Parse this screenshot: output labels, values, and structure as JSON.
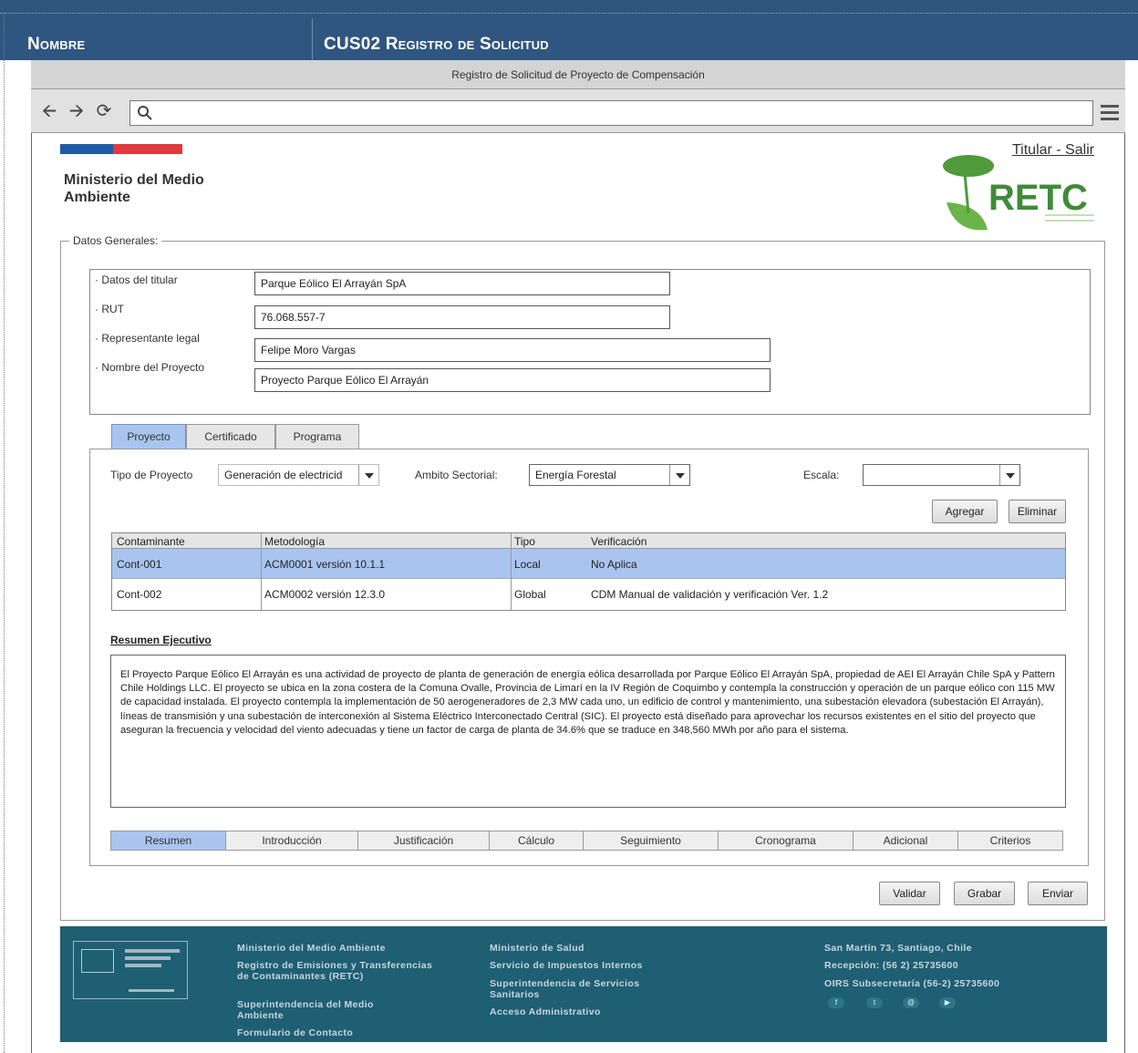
{
  "doc_header": {
    "col1": "Nombre",
    "col2": "CUS02 Registro de Solicitud"
  },
  "window": {
    "title": "Registro de Solicitud de Proyecto de Compensación"
  },
  "page_header": {
    "ministry": "Ministerio del Medio Ambiente",
    "user_link": "Titular - Salir",
    "logo_text": "RETC"
  },
  "general": {
    "legend": "Datos Generales:",
    "fields": [
      {
        "label": "· Datos del titular",
        "value": "Parque Eólico El Arrayán SpA"
      },
      {
        "label": "· RUT",
        "value": "76.068.557-7"
      },
      {
        "label": "· Representante legal",
        "value": "Felipe Moro Vargas"
      },
      {
        "label": "· Nombre del Proyecto",
        "value": "Proyecto Parque Eólico El Arrayán"
      }
    ]
  },
  "tabs": [
    "Proyecto",
    "Certificado",
    "Programa"
  ],
  "filters": {
    "tipo_label": "Tipo de Proyecto",
    "tipo_value": "Generación de electricid",
    "ambito_label": "Ambito Sectorial:",
    "ambito_value": "Energía Forestal",
    "escala_label": "Escala:",
    "escala_value": ""
  },
  "actions": {
    "add": "Agregar",
    "delete": "Eliminar"
  },
  "table": {
    "headers": [
      "Contaminante",
      "Metodología",
      "Tipo",
      "Verificación"
    ],
    "rows": [
      [
        "Cont-001",
        "ACM0001 versión 10.1.1",
        "Local",
        "No Aplica"
      ],
      [
        "Cont-002",
        "ACM0002 versión 12.3.0",
        "Global",
        "CDM Manual de validación y verificación Ver. 1.2"
      ]
    ]
  },
  "resumen": {
    "title": "Resumen Ejecutivo",
    "text": "El Proyecto Parque Eólico El Arrayán es una actividad de proyecto de planta de generación de energía eólica desarrollada por Parque Eólico El Arrayán SpA, propiedad de AEI El Arrayán Chile SpA y Pattern Chile Holdings LLC. El proyecto se ubica en la zona costera de la Comuna Ovalle, Provincia de Limarí en la IV Región de Coquimbo y contempla la construcción y operación de un parque eólico con 115 MW de capacidad instalada. El proyecto contempla la implementación de 50 aerogeneradores de 2,3 MW cada uno, un edificio de control y mantenimiento, una subestación elevadora (subestación El Arrayán), líneas de transmisión y una subestación de interconexión al Sistema Eléctrico Interconectado Central (SIC). El proyecto está diseñado para aprovechar los recursos existentes en el sitio del proyecto que aseguran la frecuencia y velocidad del viento adecuadas y tiene un factor de carga de planta de 34.6% que se traduce en 348,560 MWh por año para el sistema."
  },
  "bottom_tabs": [
    "Resumen",
    "Introducción",
    "Justificación",
    "Cálculo",
    "Seguimiento",
    "Cronograma",
    "Adicional",
    "Criterios"
  ],
  "form_buttons": {
    "validate": "Validar",
    "save": "Grabar",
    "send": "Enviar"
  },
  "footer": {
    "col1": [
      "Ministerio del Medio Ambiente",
      "Registro de Emisiones y Transferencias de Contaminantes (RETC)",
      "Superintendencia del Medio Ambiente",
      "Formulario de Contacto"
    ],
    "col2": [
      "Ministerio de Salud",
      "Servicio de Impuestos Internos",
      "Superintendencia de Servicios Sanitarios",
      "Acceso Administrativo"
    ],
    "col3": [
      "San Martín 73, Santiago, Chile",
      "Recepción: (56 2) 25735600",
      "OIRS Subsecretaría (56-2) 25735600"
    ]
  },
  "colors": {
    "header_blue": "#2f5680",
    "selection": "#a9c5ef",
    "footer": "#1f5f73"
  }
}
